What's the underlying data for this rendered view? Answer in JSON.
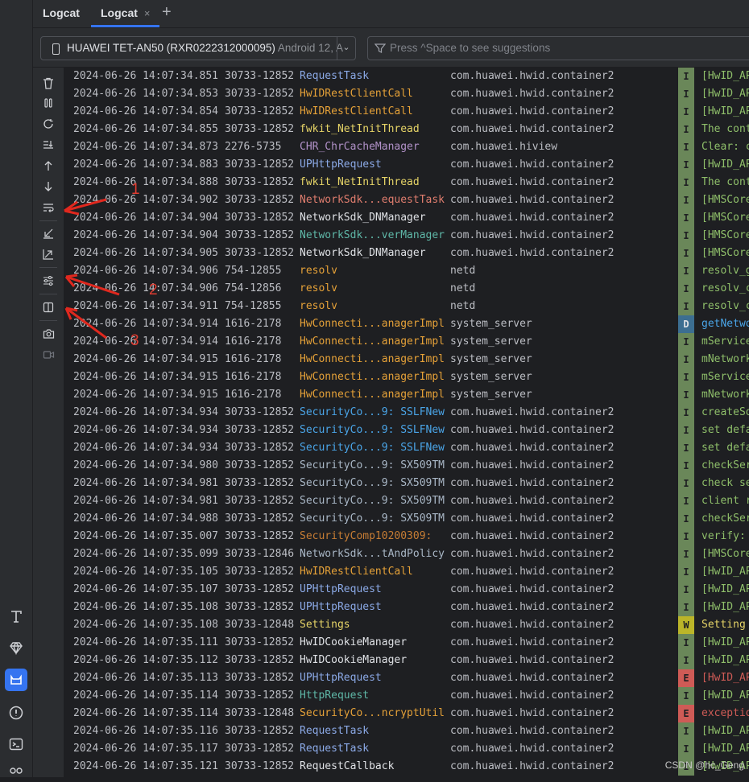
{
  "tabs": [
    {
      "label": "Logcat",
      "active": false
    },
    {
      "label": "Logcat",
      "active": true,
      "close": "×"
    }
  ],
  "tab_add": "+",
  "device": {
    "name": "HUAWEI TET-AN50 (RXR0222312000095)",
    "android": "Android 12, A"
  },
  "filter": {
    "placeholder": "Press ^Space to see suggestions"
  },
  "side_toolbar": [
    "trash-icon",
    "pause-icon",
    "restart-icon",
    "scroll-to-end-icon",
    "up-arrow-icon",
    "down-arrow-icon",
    "soft-wrap-icon",
    "collapse-icon",
    "expand-icon",
    "filter-settings-icon",
    "split-panels-icon",
    "screenshot-icon",
    "screen-record-icon"
  ],
  "left_strip_icons": [
    "text-tool-icon",
    "gem-icon",
    "logcat-cat-icon",
    "problems-icon",
    "terminal-icon",
    "services-icon"
  ],
  "annotations": [
    "1",
    "2",
    "3"
  ],
  "colors": {
    "I": "#6a8759",
    "D": "#3c6e91",
    "W": "#bbb529",
    "E": "#cf5b56",
    "tag_default": "#dfe1e5"
  },
  "logs": [
    {
      "date": "2024-06-26 14:07:34.851",
      "pid": "30733-12852",
      "tag": "RequestTask",
      "tag_color": "#8ba9e6",
      "pkg": "com.huawei.hwid.container2",
      "level": "I",
      "msg": "[HwID_AP"
    },
    {
      "date": "2024-06-26 14:07:34.853",
      "pid": "30733-12852",
      "tag": "HwIDRestClientCall",
      "tag_color": "#e5a138",
      "pkg": "com.huawei.hwid.container2",
      "level": "I",
      "msg": "[HwID_AP"
    },
    {
      "date": "2024-06-26 14:07:34.854",
      "pid": "30733-12852",
      "tag": "HwIDRestClientCall",
      "tag_color": "#e5a138",
      "pkg": "com.huawei.hwid.container2",
      "level": "I",
      "msg": "[HwID_AP"
    },
    {
      "date": "2024-06-26 14:07:34.855",
      "pid": "30733-12852",
      "tag": "fwkit_NetInitThread",
      "tag_color": "#e6d467",
      "pkg": "com.huawei.hwid.container2",
      "level": "I",
      "msg": "The cont"
    },
    {
      "date": "2024-06-26 14:07:34.873",
      "pid": "2276-5735",
      "tag": "CHR_ChrCacheManager",
      "tag_color": "#b292c9",
      "pkg": "com.huawei.hiview",
      "level": "I",
      "msg": "Clear: c"
    },
    {
      "date": "2024-06-26 14:07:34.883",
      "pid": "30733-12852",
      "tag": "UPHttpRequest",
      "tag_color": "#8ba9e6",
      "pkg": "com.huawei.hwid.container2",
      "level": "I",
      "msg": "[HwID_AP"
    },
    {
      "date": "2024-06-26 14:07:34.888",
      "pid": "30733-12852",
      "tag": "fwkit_NetInitThread",
      "tag_color": "#e6d467",
      "pkg": "com.huawei.hwid.container2",
      "level": "I",
      "msg": "The cont"
    },
    {
      "date": "2024-06-26 14:07:34.902",
      "pid": "30733-12852",
      "tag": "NetworkSdk...equestTask",
      "tag_color": "#e07d6e",
      "pkg": "com.huawei.hwid.container2",
      "level": "I",
      "msg": "[HMSCore"
    },
    {
      "date": "2024-06-26 14:07:34.904",
      "pid": "30733-12852",
      "tag": "NetworkSdk_DNManager",
      "tag_color": "#dfe1e5",
      "pkg": "com.huawei.hwid.container2",
      "level": "I",
      "msg": "[HMSCore"
    },
    {
      "date": "2024-06-26 14:07:34.904",
      "pid": "30733-12852",
      "tag": "NetworkSdk...verManager",
      "tag_color": "#5fb8a8",
      "pkg": "com.huawei.hwid.container2",
      "level": "I",
      "msg": "[HMSCore"
    },
    {
      "date": "2024-06-26 14:07:34.905",
      "pid": "30733-12852",
      "tag": "NetworkSdk_DNManager",
      "tag_color": "#dfe1e5",
      "pkg": "com.huawei.hwid.container2",
      "level": "I",
      "msg": "[HMSCore"
    },
    {
      "date": "2024-06-26 14:07:34.906",
      "pid": "754-12855",
      "tag": "resolv",
      "tag_color": "#e5a138",
      "pkg": "netd",
      "level": "I",
      "msg": "resolv_g"
    },
    {
      "date": "2024-06-26 14:07:34.906",
      "pid": "754-12856",
      "tag": "resolv",
      "tag_color": "#e5a138",
      "pkg": "netd",
      "level": "I",
      "msg": "resolv_c"
    },
    {
      "date": "2024-06-26 14:07:34.911",
      "pid": "754-12855",
      "tag": "resolv",
      "tag_color": "#e5a138",
      "pkg": "netd",
      "level": "I",
      "msg": "resolv_c"
    },
    {
      "date": "2024-06-26 14:07:34.914",
      "pid": "1616-2178",
      "tag": "HwConnecti...anagerImpl",
      "tag_color": "#e5a138",
      "pkg": "system_server",
      "level": "D",
      "msg": "getNetwo"
    },
    {
      "date": "2024-06-26 14:07:34.914",
      "pid": "1616-2178",
      "tag": "HwConnecti...anagerImpl",
      "tag_color": "#e5a138",
      "pkg": "system_server",
      "level": "I",
      "msg": "mService"
    },
    {
      "date": "2024-06-26 14:07:34.915",
      "pid": "1616-2178",
      "tag": "HwConnecti...anagerImpl",
      "tag_color": "#e5a138",
      "pkg": "system_server",
      "level": "I",
      "msg": "mNetwork"
    },
    {
      "date": "2024-06-26 14:07:34.915",
      "pid": "1616-2178",
      "tag": "HwConnecti...anagerImpl",
      "tag_color": "#e5a138",
      "pkg": "system_server",
      "level": "I",
      "msg": "mService"
    },
    {
      "date": "2024-06-26 14:07:34.915",
      "pid": "1616-2178",
      "tag": "HwConnecti...anagerImpl",
      "tag_color": "#e5a138",
      "pkg": "system_server",
      "level": "I",
      "msg": "mNetwork"
    },
    {
      "date": "2024-06-26 14:07:34.934",
      "pid": "30733-12852",
      "tag": "SecurityCo...9: SSLFNew",
      "tag_color": "#4aa5e8",
      "pkg": "com.huawei.hwid.container2",
      "level": "I",
      "msg": "createSo"
    },
    {
      "date": "2024-06-26 14:07:34.934",
      "pid": "30733-12852",
      "tag": "SecurityCo...9: SSLFNew",
      "tag_color": "#4aa5e8",
      "pkg": "com.huawei.hwid.container2",
      "level": "I",
      "msg": "set defa"
    },
    {
      "date": "2024-06-26 14:07:34.934",
      "pid": "30733-12852",
      "tag": "SecurityCo...9: SSLFNew",
      "tag_color": "#4aa5e8",
      "pkg": "com.huawei.hwid.container2",
      "level": "I",
      "msg": "set defa"
    },
    {
      "date": "2024-06-26 14:07:34.980",
      "pid": "30733-12852",
      "tag": "SecurityCo...9: SX509TM",
      "tag_color": "#a9b7c6",
      "pkg": "com.huawei.hwid.container2",
      "level": "I",
      "msg": "checkSer"
    },
    {
      "date": "2024-06-26 14:07:34.981",
      "pid": "30733-12852",
      "tag": "SecurityCo...9: SX509TM",
      "tag_color": "#a9b7c6",
      "pkg": "com.huawei.hwid.container2",
      "level": "I",
      "msg": "check se"
    },
    {
      "date": "2024-06-26 14:07:34.981",
      "pid": "30733-12852",
      "tag": "SecurityCo...9: SX509TM",
      "tag_color": "#a9b7c6",
      "pkg": "com.huawei.hwid.container2",
      "level": "I",
      "msg": "client r"
    },
    {
      "date": "2024-06-26 14:07:34.988",
      "pid": "30733-12852",
      "tag": "SecurityCo...9: SX509TM",
      "tag_color": "#a9b7c6",
      "pkg": "com.huawei.hwid.container2",
      "level": "I",
      "msg": "checkSer"
    },
    {
      "date": "2024-06-26 14:07:35.007",
      "pid": "30733-12852",
      "tag": "SecurityComp10200309:",
      "tag_color": "#c77d34",
      "pkg": "com.huawei.hwid.container2",
      "level": "I",
      "msg": "verify: "
    },
    {
      "date": "2024-06-26 14:07:35.099",
      "pid": "30733-12846",
      "tag": "NetworkSdk...tAndPolicy",
      "tag_color": "#a9b7c6",
      "pkg": "com.huawei.hwid.container2",
      "level": "I",
      "msg": "[HMSCore"
    },
    {
      "date": "2024-06-26 14:07:35.105",
      "pid": "30733-12852",
      "tag": "HwIDRestClientCall",
      "tag_color": "#e5a138",
      "pkg": "com.huawei.hwid.container2",
      "level": "I",
      "msg": "[HwID_AP"
    },
    {
      "date": "2024-06-26 14:07:35.107",
      "pid": "30733-12852",
      "tag": "UPHttpRequest",
      "tag_color": "#8ba9e6",
      "pkg": "com.huawei.hwid.container2",
      "level": "I",
      "msg": "[HwID_AP"
    },
    {
      "date": "2024-06-26 14:07:35.108",
      "pid": "30733-12852",
      "tag": "UPHttpRequest",
      "tag_color": "#8ba9e6",
      "pkg": "com.huawei.hwid.container2",
      "level": "I",
      "msg": "[HwID_AP"
    },
    {
      "date": "2024-06-26 14:07:35.108",
      "pid": "30733-12848",
      "tag": "Settings",
      "tag_color": "#e6d467",
      "pkg": "com.huawei.hwid.container2",
      "level": "W",
      "msg": "Setting "
    },
    {
      "date": "2024-06-26 14:07:35.111",
      "pid": "30733-12852",
      "tag": "HwIDCookieManager",
      "tag_color": "#dfe1e5",
      "pkg": "com.huawei.hwid.container2",
      "level": "I",
      "msg": "[HwID_AP"
    },
    {
      "date": "2024-06-26 14:07:35.112",
      "pid": "30733-12852",
      "tag": "HwIDCookieManager",
      "tag_color": "#dfe1e5",
      "pkg": "com.huawei.hwid.container2",
      "level": "I",
      "msg": "[HwID_AP"
    },
    {
      "date": "2024-06-26 14:07:35.113",
      "pid": "30733-12852",
      "tag": "UPHttpRequest",
      "tag_color": "#8ba9e6",
      "pkg": "com.huawei.hwid.container2",
      "level": "E",
      "msg": "[HwID_AP"
    },
    {
      "date": "2024-06-26 14:07:35.114",
      "pid": "30733-12852",
      "tag": "HttpRequest",
      "tag_color": "#5fb8a8",
      "pkg": "com.huawei.hwid.container2",
      "level": "I",
      "msg": "[HwID_AP"
    },
    {
      "date": "2024-06-26 14:07:35.114",
      "pid": "30733-12848",
      "tag": "SecurityCo...ncryptUtil",
      "tag_color": "#e5a138",
      "pkg": "com.huawei.hwid.container2",
      "level": "E",
      "msg": "exceptio"
    },
    {
      "date": "2024-06-26 14:07:35.116",
      "pid": "30733-12852",
      "tag": "RequestTask",
      "tag_color": "#8ba9e6",
      "pkg": "com.huawei.hwid.container2",
      "level": "I",
      "msg": "[HwID_AP"
    },
    {
      "date": "2024-06-26 14:07:35.117",
      "pid": "30733-12852",
      "tag": "RequestTask",
      "tag_color": "#8ba9e6",
      "pkg": "com.huawei.hwid.container2",
      "level": "I",
      "msg": "[HwID_AP"
    },
    {
      "date": "2024-06-26 14:07:35.121",
      "pid": "30733-12852",
      "tag": "RequestCallback",
      "tag_color": "#dfe1e5",
      "pkg": "com.huawei.hwid.container2",
      "level": "I",
      "msg": "[HwID_AP"
    }
  ],
  "watermark": "CSDN @hc_Geng"
}
